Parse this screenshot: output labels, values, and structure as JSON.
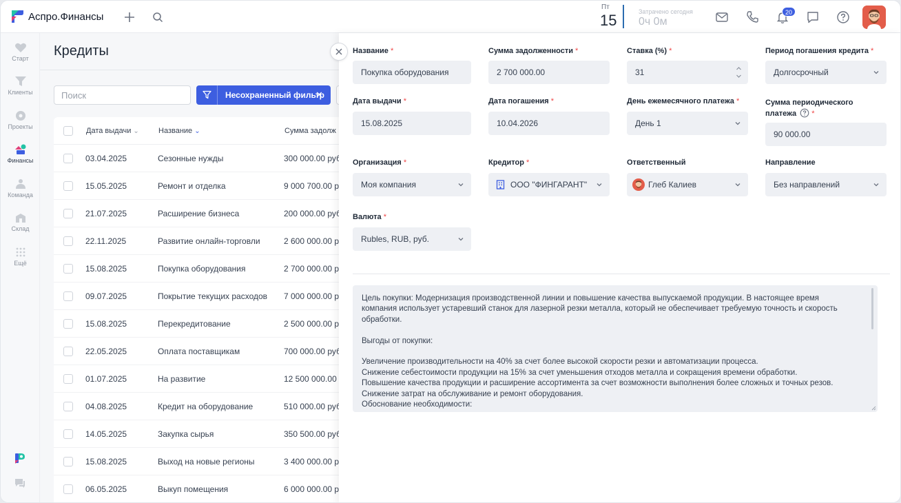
{
  "app": {
    "title": "Аспро.Финансы"
  },
  "header": {
    "day_of_week": "Пт",
    "day_number": "15",
    "spent_label": "Затрачено сегодня",
    "spent_value": "0ч 0м",
    "notifications_count": "20"
  },
  "sidebar": {
    "items": [
      {
        "label": "Старт",
        "icon": "heart-icon"
      },
      {
        "label": "Клиенты",
        "icon": "funnel-icon"
      },
      {
        "label": "Проекты",
        "icon": "projects-icon"
      },
      {
        "label": "Финансы",
        "icon": "finance-icon"
      },
      {
        "label": "Команда",
        "icon": "team-icon"
      },
      {
        "label": "Склад",
        "icon": "warehouse-icon"
      },
      {
        "label": "Ещё",
        "icon": "grid-icon"
      }
    ]
  },
  "list": {
    "title": "Кредиты",
    "search_placeholder": "Поиск",
    "filter_label": "Несохраненный фильтр",
    "columns": {
      "date": "Дата выдачи",
      "name": "Название",
      "amount": "Сумма задолж"
    },
    "rows": [
      {
        "date": "03.04.2025",
        "name": "Сезонные нужды",
        "amount": "300 000.00 руб"
      },
      {
        "date": "15.05.2025",
        "name": "Ремонт и отделка",
        "amount": "9 000 700.00 ру"
      },
      {
        "date": "21.07.2025",
        "name": "Расширение бизнеса",
        "amount": "200 000.00 руб"
      },
      {
        "date": "22.11.2025",
        "name": "Развитие онлайн-торговли",
        "amount": "2 600 000.00 р"
      },
      {
        "date": "15.08.2025",
        "name": "Покупка оборудования",
        "amount": "2 700 000.00 р"
      },
      {
        "date": "09.07.2025",
        "name": "Покрытие текущих расходов",
        "amount": "7 000 000.00 р"
      },
      {
        "date": "15.08.2025",
        "name": "Перекредитование",
        "amount": "2 500 000.00 р"
      },
      {
        "date": "22.05.2025",
        "name": "Оплата поставщикам",
        "amount": "700 000.00 руб"
      },
      {
        "date": "01.07.2025",
        "name": "На развитие",
        "amount": "12 500 000.00 р"
      },
      {
        "date": "04.08.2025",
        "name": "Кредит на оборудование",
        "amount": "510 000.00 руб"
      },
      {
        "date": "14.05.2025",
        "name": "Закупка сырья",
        "amount": "350 500.00 руб"
      },
      {
        "date": "15.08.2025",
        "name": "Выход на новые регионы",
        "amount": "3 400 000.00 р"
      },
      {
        "date": "06.05.2025",
        "name": "Выкуп помещения",
        "amount": "6 000 000.00 р"
      }
    ]
  },
  "form": {
    "name": {
      "label": "Название",
      "value": "Покупка оборудования"
    },
    "debt": {
      "label": "Сумма задолженности",
      "value": "2 700 000.00"
    },
    "rate": {
      "label": "Ставка (%)",
      "value": "31"
    },
    "period": {
      "label": "Период погашения кредита",
      "value": "Долгосрочный"
    },
    "issue_date": {
      "label": "Дата выдачи",
      "value": "15.08.2025"
    },
    "repay_date": {
      "label": "Дата погашения",
      "value": "10.04.2026"
    },
    "payday": {
      "label": "День ежемесячного платежа",
      "value": "День 1"
    },
    "periodic": {
      "label_line1": "Сумма периодического",
      "label_line2": "платежа",
      "value": "90 000.00"
    },
    "org": {
      "label": "Организация",
      "value": "Моя компания"
    },
    "creditor": {
      "label": "Кредитор",
      "value": "ООО \"ФИНГАРАНТ\""
    },
    "responsible": {
      "label": "Ответственный",
      "value": "Глеб Калиев"
    },
    "direction": {
      "label": "Направление",
      "value": "Без направлений"
    },
    "currency": {
      "label": "Валюта",
      "value": "Rubles, RUB, руб."
    },
    "required_mark": "*",
    "description": [
      "Цель покупки: Модернизация производственной линии и повышение качества выпускаемой продукции. В настоящее время",
      "компания использует устаревший станок для лазерной резки металла, который не обеспечивает требуемую точность и скорость",
      "обработки.",
      "",
      "Выгоды от покупки:",
      "",
      "Увеличение производительности на 40% за счет более высокой скорости резки и автоматизации процесса.",
      "Снижение себестоимости продукции на 15% за счет уменьшения отходов металла и сокращения времени обработки.",
      "Повышение качества продукции и расширение ассортимента за счет возможности выполнения более сложных и точных резов.",
      "Снижение затрат на обслуживание и ремонт оборудования.",
      "Обоснование необходимости:"
    ]
  }
}
